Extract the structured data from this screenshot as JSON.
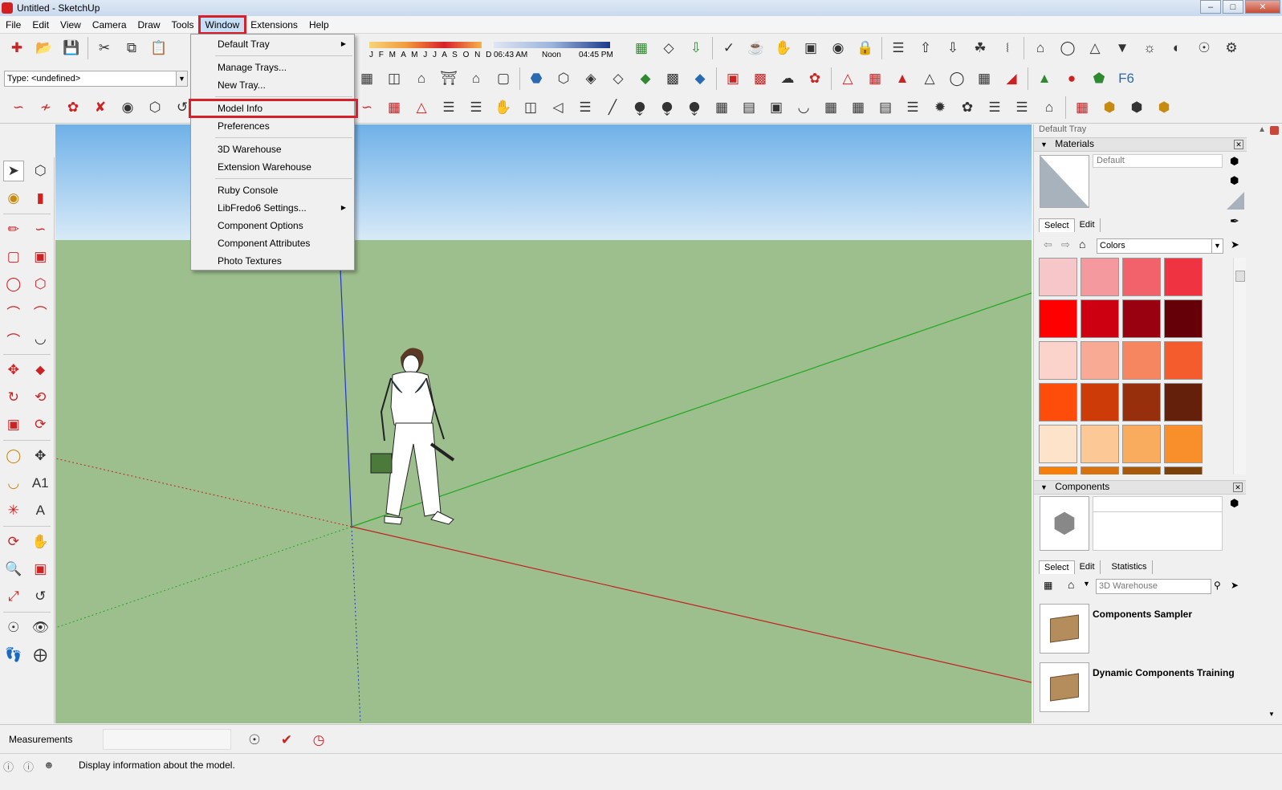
{
  "window": {
    "title": "Untitled - SketchUp",
    "controls": [
      "minimize-icon",
      "maximize-icon",
      "close-icon"
    ]
  },
  "menubar": {
    "items": [
      {
        "label": "File"
      },
      {
        "label": "Edit"
      },
      {
        "label": "View"
      },
      {
        "label": "Camera"
      },
      {
        "label": "Draw"
      },
      {
        "label": "Tools"
      },
      {
        "label": "Window",
        "active": true
      },
      {
        "label": "Extensions"
      },
      {
        "label": "Help"
      }
    ]
  },
  "window_menu": {
    "items": [
      {
        "label": "Default Tray",
        "submenu": true
      },
      {
        "label": "Manage Trays..."
      },
      {
        "label": "New Tray..."
      },
      {
        "label": "Model Info",
        "highlighted": true
      },
      {
        "label": "Preferences"
      },
      {
        "label": "3D Warehouse"
      },
      {
        "label": "Extension Warehouse"
      },
      {
        "label": "Ruby Console"
      },
      {
        "label": "LibFredo6 Settings...",
        "submenu": true
      },
      {
        "label": "Component Options"
      },
      {
        "label": "Component Attributes"
      },
      {
        "label": "Photo Textures"
      }
    ]
  },
  "toolbar": {
    "type_label": "Type: <undefined>",
    "shadow": {
      "months": "J F M A M J J A S O N D",
      "time_start": "06:43 AM",
      "time_mid": "Noon",
      "time_end": "04:45 PM"
    }
  },
  "tray": {
    "title": "Default Tray",
    "materials": {
      "title": "Materials",
      "material_name": "Default",
      "tab_select": "Select",
      "tab_edit": "Edit",
      "library": "Colors",
      "swatches": [
        "#f7c6c9",
        "#f49a9f",
        "#f1626a",
        "#ef3340",
        "#ff0000",
        "#cc0011",
        "#990010",
        "#660008",
        "#fcd3cb",
        "#f8aa95",
        "#f6865f",
        "#f45c2e",
        "#fe4c0a",
        "#cd3b08",
        "#972e0c",
        "#64200b",
        "#fde3c9",
        "#fbc896",
        "#f9ac5e",
        "#f88f2b",
        "#f67f0a",
        "#d87210",
        "#a85a0c",
        "#7a410a"
      ]
    },
    "components": {
      "title": "Components",
      "tab_select": "Select",
      "tab_edit": "Edit",
      "tab_statistics": "Statistics",
      "search_placeholder": "3D Warehouse",
      "items": [
        {
          "name": "Components Sampler"
        },
        {
          "name": "Dynamic Components Training"
        }
      ]
    }
  },
  "measurements": {
    "label": "Measurements"
  },
  "status": {
    "text": "Display information about the model."
  }
}
